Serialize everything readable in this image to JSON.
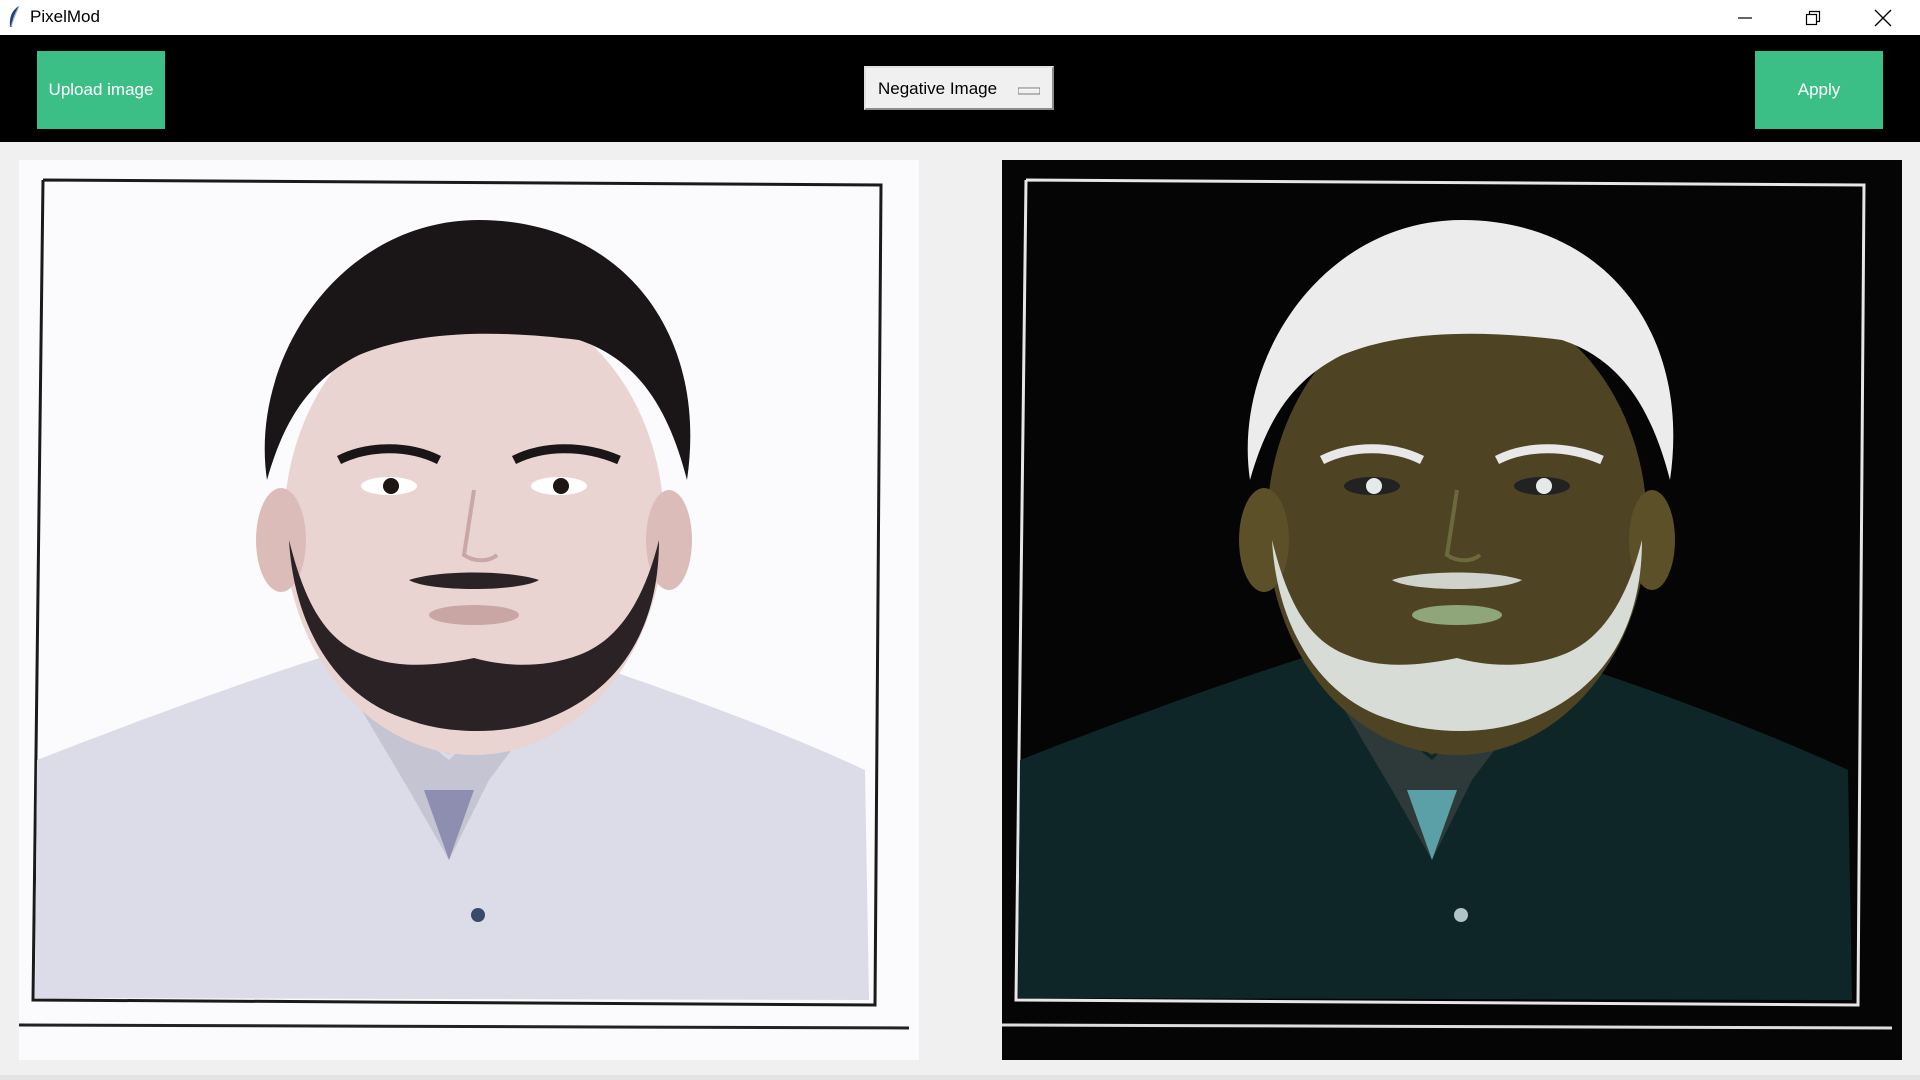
{
  "window": {
    "title": "PixelMod",
    "app_icon": "feather-icon",
    "controls": [
      "minimize-icon",
      "restore-icon",
      "close-icon"
    ]
  },
  "toolbar": {
    "upload_label": "Upload image",
    "filter_selected": "Negative Image",
    "apply_label": "Apply",
    "accent_color": "#3cbf86",
    "background_color": "#000000"
  },
  "images": {
    "original": {
      "description_icon": "portrait-photo"
    },
    "processed": {
      "description_icon": "negative-portrait-photo"
    }
  }
}
